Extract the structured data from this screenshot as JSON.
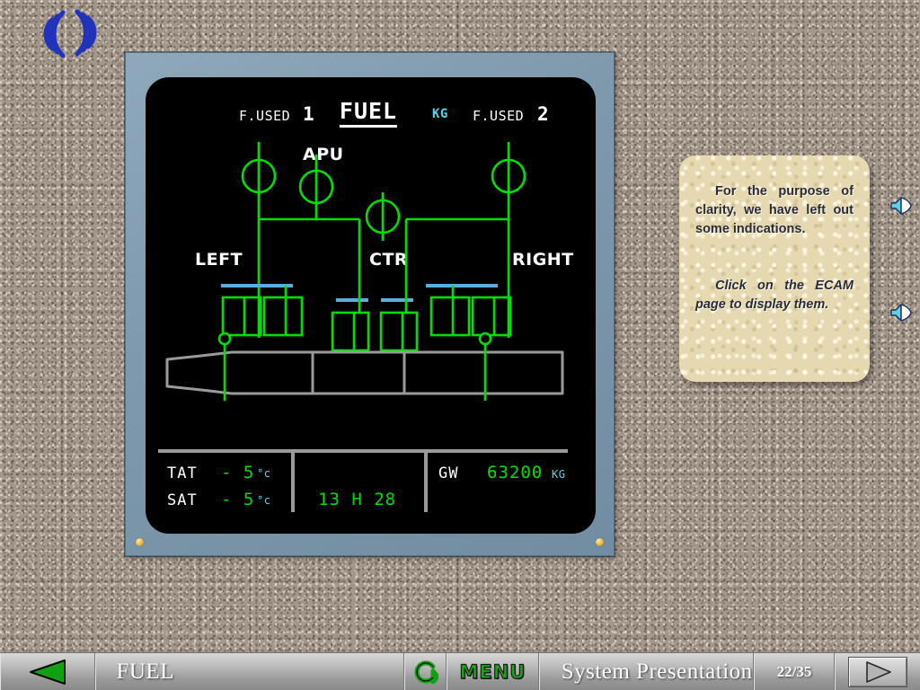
{
  "app": {
    "background_color": "#a3978b",
    "logo_name": "swirl-logo",
    "logo_color": "#2233bb"
  },
  "ecam": {
    "bezel_color": "#7e99ac",
    "screen_color": "#000000",
    "title": "FUEL",
    "unit": "KG",
    "unit_color": "#4fd8e8",
    "fuel_used": [
      {
        "label": "F.USED",
        "engine": "1"
      },
      {
        "label": "F.USED",
        "engine": "2"
      }
    ],
    "labels": {
      "apu": "APU",
      "left": "LEFT",
      "ctr": "CTR",
      "right": "RIGHT"
    },
    "line_color": "#00e000",
    "valve_color": "#00e000",
    "xfeed_bar_color": "#5aaedd",
    "tank_outline_color": "#9a9a9a",
    "data": {
      "tat_label": "TAT",
      "tat_value": "- 5",
      "tat_unit": "°c",
      "sat_label": "SAT",
      "sat_value": "- 5",
      "sat_unit": "°c",
      "clock": "13 H 28",
      "gw_label": "GW",
      "gw_value": "63200",
      "gw_unit": "KG",
      "value_color": "#00e000",
      "unit_color": "#4fd8e8"
    }
  },
  "note": {
    "paragraph_1": "For the purpose of clarity, we have left out some indications.",
    "paragraph_2": "Click on the ECAM page to display them.",
    "panel_color": "#e6d9b2"
  },
  "audio": {
    "speaker_1_name": "speaker-icon",
    "speaker_2_name": "speaker-icon",
    "icon_color": "#5fd0e0"
  },
  "toolbar": {
    "prev_label": "previous-arrow",
    "title": "FUEL",
    "reset_label": "restart-icon",
    "menu_label": "MENU",
    "menu_color": "#16a616",
    "section": "System Presentation",
    "page": "22/35",
    "next_label": "next-arrow"
  }
}
